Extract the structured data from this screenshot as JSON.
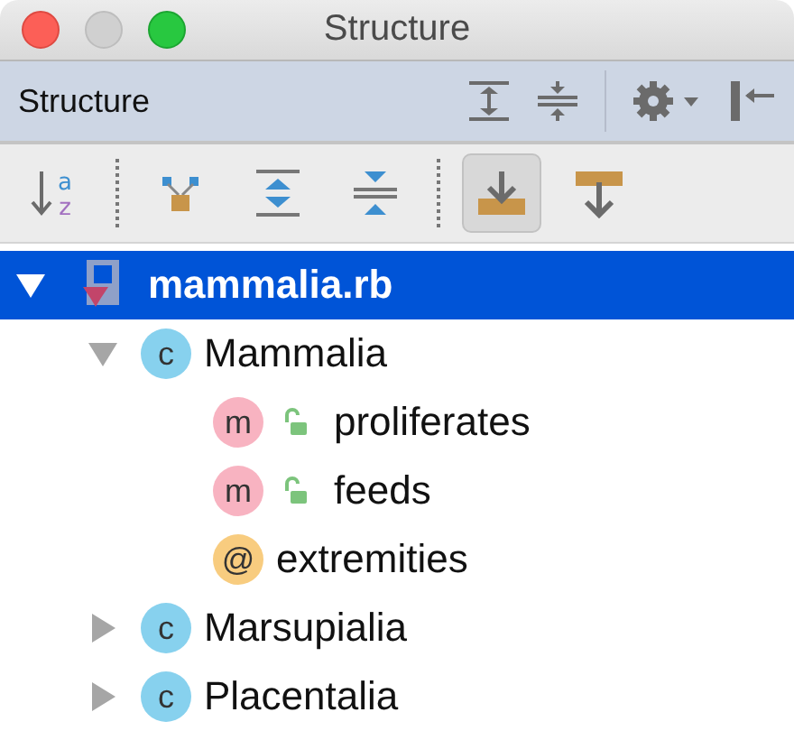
{
  "window": {
    "title": "Structure"
  },
  "panel": {
    "title": "Structure",
    "tools": [
      {
        "kind": "expand-all"
      },
      {
        "kind": "collapse-all"
      },
      {
        "kind": "divider"
      },
      {
        "kind": "settings"
      },
      {
        "kind": "hide"
      }
    ]
  },
  "toolbar": [
    {
      "kind": "sort",
      "letters": [
        "a",
        "z"
      ],
      "selected": false
    },
    {
      "kind": "divider"
    },
    {
      "kind": "hierarchy",
      "selected": false
    },
    {
      "kind": "expand",
      "selected": false
    },
    {
      "kind": "collapse",
      "selected": false
    },
    {
      "kind": "divider"
    },
    {
      "kind": "scroll-to-source",
      "selected": true
    },
    {
      "kind": "scroll-from-source",
      "selected": false
    }
  ],
  "tree": [
    {
      "kind": "file",
      "label": "mammalia.rb",
      "expanded": true,
      "selected": true,
      "children": [
        {
          "kind": "class",
          "badge": "c",
          "label": "Mammalia",
          "expanded": true,
          "selected": false,
          "children": [
            {
              "kind": "method",
              "badge": "m",
              "label": "proliferates",
              "public": true,
              "selected": false
            },
            {
              "kind": "method",
              "badge": "m",
              "label": "feeds",
              "public": true,
              "selected": false
            },
            {
              "kind": "attribute",
              "badge": "@",
              "label": "extremities",
              "selected": false
            }
          ]
        },
        {
          "kind": "class",
          "badge": "c",
          "label": "Marsupialia",
          "expanded": false,
          "selected": false
        },
        {
          "kind": "class",
          "badge": "c",
          "label": "Placentalia",
          "expanded": false,
          "selected": false
        }
      ]
    }
  ]
}
